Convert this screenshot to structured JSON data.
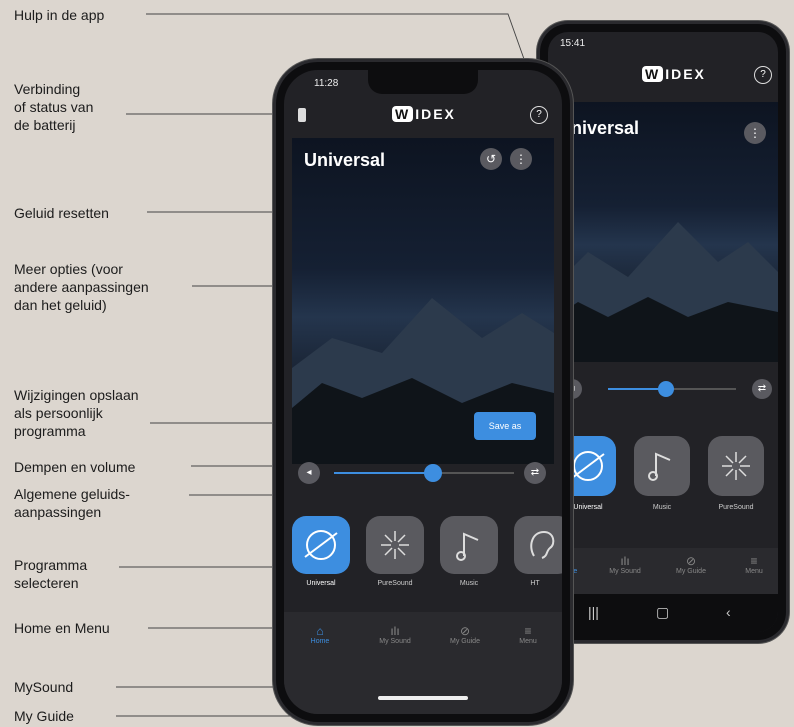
{
  "callouts": {
    "help": "Hulp in de app",
    "connection": "Verbinding\nof status van\nde batterij",
    "reset": "Geluid resetten",
    "more_options": "Meer opties (voor\nandere aanpassingen\ndan het geluid)",
    "save": "Wijzigingen opslaan\nals persoonlijk\nprogramma",
    "mute_volume": "Dempen en volume",
    "general_sound": "Algemene geluids-\naanpassingen",
    "program_select": "Programma\nselecteren",
    "home_menu": "Home en Menu",
    "mysound": "MySound",
    "myguide": "My Guide"
  },
  "front_phone": {
    "time": "11:28",
    "logo": "IDEX",
    "logo_w": "W",
    "program_title": "Universal",
    "save_label": "Save as",
    "programs": [
      "Universal",
      "PureSound",
      "Music",
      "HT"
    ],
    "nav": [
      "Home",
      "My Sound",
      "My Guide",
      "Menu"
    ],
    "volume_level": 0.55
  },
  "back_phone": {
    "time": "15:41",
    "logo": "IDEX",
    "logo_w": "W",
    "program_title": "Universal",
    "programs": [
      "Universal",
      "Music",
      "PureSound"
    ],
    "nav": [
      "Home",
      "My Sound",
      "My Guide",
      "Menu"
    ],
    "volume_level": 0.45
  },
  "colors": {
    "accent": "#3d8ee0",
    "background": "#dcd6cf"
  }
}
